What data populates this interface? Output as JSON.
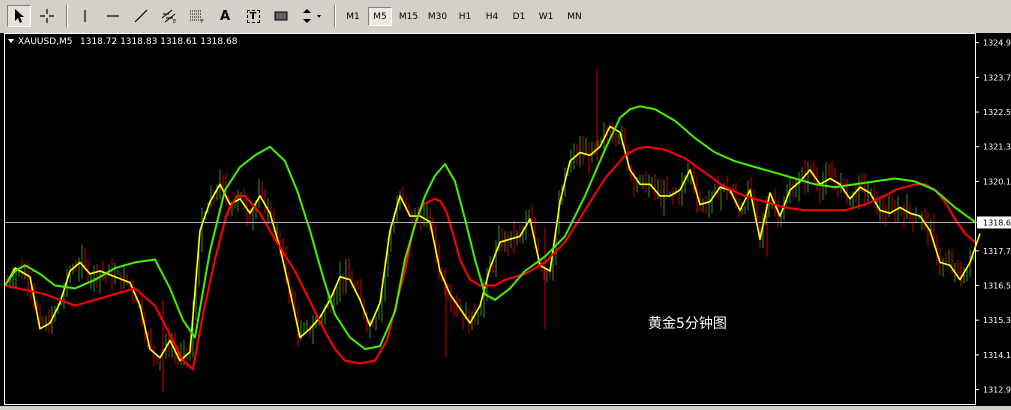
{
  "toolbar": {
    "tools": [
      {
        "name": "cursor-icon",
        "pressed": true
      },
      {
        "name": "crosshair-icon",
        "pressed": false
      },
      {
        "name": "vertical-line-icon",
        "pressed": false
      },
      {
        "name": "horizontal-line-icon",
        "pressed": false
      },
      {
        "name": "trendline-icon",
        "pressed": false
      },
      {
        "name": "equidistant-channel-icon",
        "pressed": false
      },
      {
        "name": "fibonacci-icon",
        "pressed": false
      },
      {
        "name": "text-icon",
        "label": "A",
        "pressed": false
      },
      {
        "name": "text-label-icon",
        "label": "T",
        "pressed": false
      },
      {
        "name": "rectangle-icon",
        "pressed": false
      },
      {
        "name": "arrows-dropdown-icon",
        "pressed": false
      }
    ],
    "timeframes": [
      "M1",
      "M5",
      "M15",
      "M30",
      "H1",
      "H4",
      "D1",
      "W1",
      "MN"
    ],
    "active_timeframe": "M5"
  },
  "chart_header": {
    "symbol": "XAUUSD,M5",
    "ohlc": "1318.72 1318.83 1318.61 1318.68"
  },
  "annotation": "黄金5分钟图",
  "colors": {
    "background": "#000000",
    "bull_candle": "#2e8b2e",
    "bear_candle": "#cc0000",
    "yellow_line": "#ffff00",
    "red_line": "#ff0000",
    "green_line": "#44ee00",
    "axis": "#ffffff",
    "current_price_line": "#b0b0b0"
  },
  "chart_data": {
    "type": "line",
    "title": "XAUUSD,M5",
    "ylim": [
      1312.4,
      1325.2
    ],
    "yticks": [
      "1324.9",
      "1323.7",
      "1322.5",
      "1321.3",
      "1320.1",
      "1318.6",
      "1317.7",
      "1316.5",
      "1315.3",
      "1314.1",
      "1312.9"
    ],
    "ytick_values": [
      1324.9,
      1323.7,
      1322.5,
      1321.3,
      1320.1,
      1318.68,
      1317.7,
      1316.5,
      1315.3,
      1314.1,
      1312.9
    ],
    "current_price": 1318.68,
    "grid": false,
    "series": [
      {
        "color": "yellow",
        "x": [
          0,
          10,
          25,
          35,
          45,
          55,
          65,
          75,
          85,
          95,
          110,
          125,
          135,
          145,
          155,
          165,
          175,
          185,
          195,
          205,
          215,
          225,
          235,
          245,
          255,
          265,
          275,
          285,
          295,
          305,
          315,
          325,
          335,
          345,
          355,
          365,
          375,
          385,
          395,
          405,
          415,
          425,
          435,
          445,
          455,
          465,
          475,
          485,
          495,
          505,
          515,
          525,
          535,
          545,
          555,
          565,
          575,
          585,
          595,
          605,
          615,
          625,
          635,
          645,
          655,
          665,
          675,
          685,
          695,
          705,
          715,
          725,
          735,
          745,
          755,
          765,
          775,
          785,
          795,
          805,
          815,
          825,
          835,
          845,
          855,
          865,
          875,
          885,
          895,
          905,
          915,
          925,
          935,
          945,
          955,
          965,
          975
        ],
        "y": [
          1316.5,
          1317.1,
          1316.8,
          1315.0,
          1315.2,
          1315.9,
          1317.0,
          1317.3,
          1316.9,
          1317.0,
          1316.8,
          1316.6,
          1315.8,
          1314.3,
          1314.0,
          1314.6,
          1313.9,
          1314.2,
          1318.4,
          1319.4,
          1320.0,
          1319.3,
          1319.5,
          1319.0,
          1319.6,
          1319.0,
          1317.8,
          1316.3,
          1314.7,
          1315.0,
          1315.4,
          1316.0,
          1316.8,
          1316.7,
          1316.0,
          1315.1,
          1315.9,
          1318.4,
          1319.6,
          1318.9,
          1318.9,
          1318.7,
          1317.0,
          1316.2,
          1315.7,
          1315.2,
          1315.8,
          1317.1,
          1318.0,
          1318.1,
          1318.2,
          1318.8,
          1317.2,
          1317.0,
          1319.4,
          1320.8,
          1321.1,
          1321.0,
          1321.3,
          1322.0,
          1321.8,
          1320.5,
          1320.0,
          1320.0,
          1319.6,
          1319.6,
          1319.8,
          1320.5,
          1319.3,
          1319.4,
          1319.9,
          1319.8,
          1319.1,
          1319.8,
          1318.1,
          1319.7,
          1318.9,
          1319.8,
          1320.1,
          1320.5,
          1320.0,
          1320.2,
          1320.0,
          1319.5,
          1319.9,
          1319.7,
          1319.1,
          1319.0,
          1319.2,
          1319.0,
          1318.9,
          1318.4,
          1317.3,
          1317.2,
          1316.7,
          1317.3,
          1318.3
        ]
      },
      {
        "color": "red",
        "x": [
          0,
          40,
          70,
          100,
          130,
          150,
          165,
          178,
          188,
          198,
          210,
          222,
          232,
          240,
          255,
          270,
          290,
          310,
          320,
          330,
          340,
          355,
          370,
          382,
          390,
          400,
          408,
          414,
          418,
          424,
          430,
          436,
          442,
          448,
          455,
          465,
          475,
          484,
          490,
          500,
          520,
          540,
          560,
          580,
          600,
          610,
          620,
          630,
          640,
          660,
          680,
          700,
          720,
          740,
          760,
          780,
          800,
          820,
          840,
          860,
          880,
          890,
          900,
          910,
          920,
          930,
          940,
          950,
          960,
          970
        ],
        "y": [
          1316.5,
          1316.2,
          1315.8,
          1316.1,
          1316.4,
          1315.8,
          1314.8,
          1313.9,
          1313.6,
          1315.5,
          1317.4,
          1319.0,
          1319.6,
          1319.6,
          1319.0,
          1318.1,
          1317.0,
          1315.6,
          1314.9,
          1314.3,
          1313.9,
          1313.8,
          1313.9,
          1314.6,
          1315.7,
          1317.0,
          1318.4,
          1319.0,
          1319.3,
          1319.4,
          1319.5,
          1319.4,
          1319.0,
          1318.3,
          1317.4,
          1316.7,
          1316.5,
          1316.5,
          1316.5,
          1316.7,
          1316.9,
          1317.3,
          1318.0,
          1319.1,
          1320.2,
          1320.6,
          1321.0,
          1321.2,
          1321.3,
          1321.2,
          1320.9,
          1320.4,
          1319.9,
          1319.6,
          1319.4,
          1319.2,
          1319.1,
          1319.1,
          1319.1,
          1319.3,
          1319.6,
          1319.8,
          1319.9,
          1320.0,
          1320.0,
          1319.8,
          1319.4,
          1318.8,
          1318.3,
          1318.0
        ]
      },
      {
        "color": "green",
        "x": [
          0,
          10,
          20,
          35,
          50,
          70,
          90,
          110,
          130,
          150,
          165,
          178,
          190,
          205,
          220,
          235,
          250,
          265,
          280,
          292,
          305,
          318,
          330,
          345,
          360,
          375,
          390,
          400,
          410,
          420,
          430,
          440,
          450,
          460,
          470,
          480,
          490,
          505,
          520,
          540,
          560,
          580,
          600,
          615,
          625,
          635,
          650,
          670,
          690,
          710,
          730,
          750,
          770,
          790,
          810,
          830,
          850,
          870,
          890,
          910,
          930,
          950,
          970
        ],
        "y": [
          1316.5,
          1317.0,
          1317.2,
          1316.9,
          1316.5,
          1316.4,
          1316.7,
          1317.1,
          1317.3,
          1317.4,
          1316.4,
          1315.3,
          1314.7,
          1317.7,
          1319.8,
          1320.6,
          1321.0,
          1321.3,
          1320.8,
          1319.8,
          1318.4,
          1316.8,
          1315.5,
          1314.7,
          1314.3,
          1314.4,
          1315.6,
          1317.4,
          1318.6,
          1319.6,
          1320.3,
          1320.7,
          1320.1,
          1318.8,
          1317.4,
          1316.2,
          1316.0,
          1316.4,
          1317.0,
          1317.5,
          1318.2,
          1319.6,
          1321.2,
          1322.3,
          1322.6,
          1322.7,
          1322.6,
          1322.2,
          1321.6,
          1321.1,
          1320.8,
          1320.6,
          1320.4,
          1320.2,
          1320.0,
          1319.9,
          1320.0,
          1320.1,
          1320.2,
          1320.1,
          1319.8,
          1319.2,
          1318.7
        ]
      }
    ]
  }
}
